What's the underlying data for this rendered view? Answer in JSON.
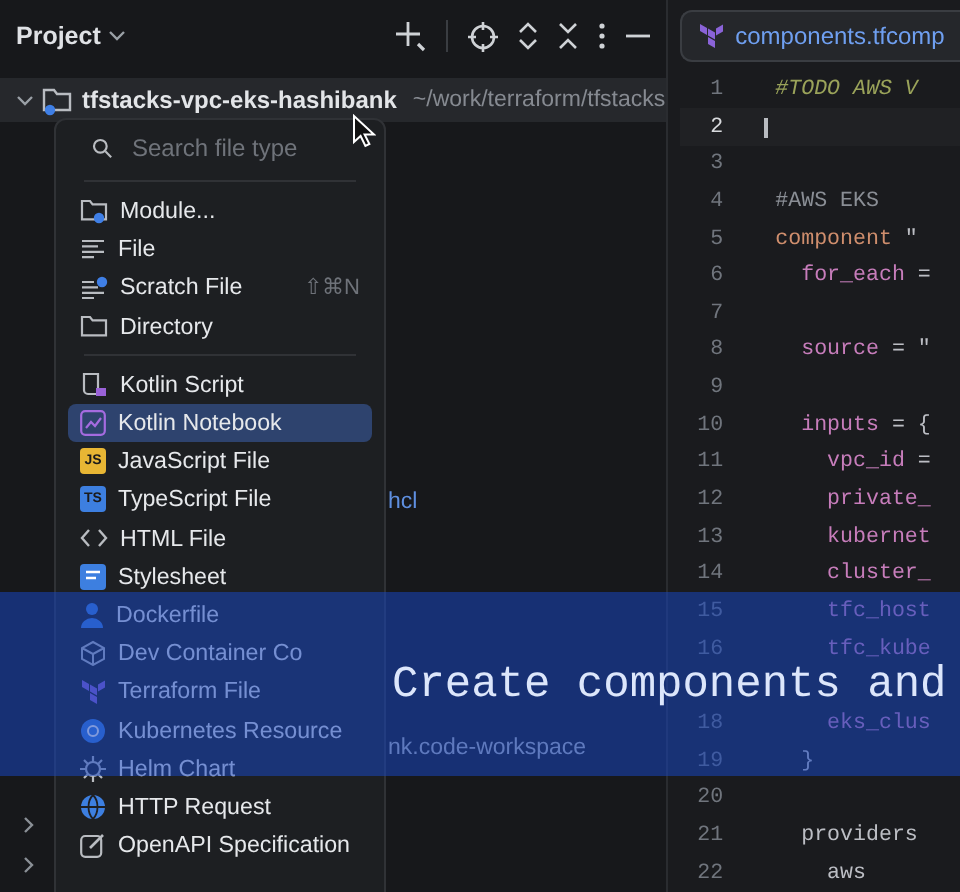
{
  "project_panel": {
    "title": "Project",
    "root": {
      "name": "tfstacks-vpc-eks-hashibank",
      "path": "~/work/terraform/tfstacks",
      "expanded": true
    },
    "rows": [
      {
        "text": "hcl"
      },
      {
        "text": "nk.code-workspace"
      }
    ],
    "collapsed_rows": [
      {
        "expanded": false
      },
      {
        "expanded": false
      }
    ]
  },
  "new_file_menu": {
    "search": {
      "placeholder": "Search file type"
    },
    "groups": [
      [
        {
          "label": "Module...",
          "kind": "module",
          "selected": false
        },
        {
          "label": "File",
          "kind": "file",
          "selected": false
        },
        {
          "label": "Scratch File",
          "kind": "scratch",
          "shortcut": "⇧⌘N",
          "selected": false
        },
        {
          "label": "Directory",
          "kind": "folder",
          "selected": false
        }
      ],
      [
        {
          "label": "Kotlin Script",
          "kind": "kscript",
          "selected": false
        },
        {
          "label": "Kotlin Notebook",
          "kind": "notebook",
          "selected": true
        },
        {
          "label": "JavaScript File",
          "kind": "badge",
          "badge": "JS",
          "color": "#e8b634",
          "selected": false
        },
        {
          "label": "TypeScript File",
          "kind": "badge",
          "badge": "TS",
          "color": "#3d7fe0",
          "selected": false
        },
        {
          "label": "HTML File",
          "kind": "html",
          "selected": false
        },
        {
          "label": "Stylesheet",
          "kind": "css",
          "selected": false
        },
        {
          "label": "Dockerfile",
          "kind": "docker",
          "selected": false
        },
        {
          "label": "Dev Container Co",
          "kind": "cube",
          "selected": false
        },
        {
          "label": "Terraform File",
          "kind": "terraform",
          "selected": false
        },
        {
          "label": "Kubernetes Resource",
          "kind": "k8s",
          "selected": false
        },
        {
          "label": "Helm Chart",
          "kind": "helm",
          "selected": false
        },
        {
          "label": "HTTP Request",
          "kind": "globe",
          "selected": false
        },
        {
          "label": "OpenAPI Specification",
          "kind": "openapi",
          "selected": false
        }
      ]
    ]
  },
  "editor": {
    "tab": "components.tfcomp",
    "lines": [
      {
        "num": "1",
        "current": false,
        "tokens": [
          {
            "text": "#TODO AWS V",
            "kind": "todo"
          }
        ]
      },
      {
        "num": "2",
        "current": true
      },
      {
        "num": "3",
        "current": false
      },
      {
        "num": "4",
        "current": false,
        "tokens": [
          {
            "text": "#AWS EKS",
            "kind": "comment"
          }
        ]
      },
      {
        "num": "5",
        "current": false,
        "tokens": [
          {
            "text": "component",
            "kind": "keyword"
          },
          {
            "text": " \"",
            "kind": "plain"
          }
        ]
      },
      {
        "num": "6",
        "current": false,
        "tokens": [
          {
            "text": "  for_each",
            "kind": "prop"
          },
          {
            "text": " =",
            "kind": "plain"
          }
        ]
      },
      {
        "num": "7",
        "current": false
      },
      {
        "num": "8",
        "current": false,
        "tokens": [
          {
            "text": "  source",
            "kind": "prop"
          },
          {
            "text": " = \"",
            "kind": "plain"
          }
        ]
      },
      {
        "num": "9",
        "current": false
      },
      {
        "num": "10",
        "current": false,
        "tokens": [
          {
            "text": "  inputs",
            "kind": "prop"
          },
          {
            "text": " = {",
            "kind": "plain"
          }
        ]
      },
      {
        "num": "11",
        "current": false,
        "tokens": [
          {
            "text": "    vpc_id",
            "kind": "prop"
          },
          {
            "text": " =",
            "kind": "plain"
          }
        ]
      },
      {
        "num": "12",
        "current": false,
        "tokens": [
          {
            "text": "    private_",
            "kind": "prop"
          }
        ]
      },
      {
        "num": "13",
        "current": false,
        "tokens": [
          {
            "text": "    kubernet",
            "kind": "prop"
          }
        ]
      },
      {
        "num": "14",
        "current": false,
        "tokens": [
          {
            "text": "    cluster_",
            "kind": "prop"
          }
        ]
      },
      {
        "num": "15",
        "current": false,
        "tokens": [
          {
            "text": "    tfc_host",
            "kind": "prop"
          }
        ]
      },
      {
        "num": "16",
        "current": false,
        "tokens": [
          {
            "text": "    tfc_kube",
            "kind": "prop"
          }
        ]
      },
      {
        "current": false
      },
      {
        "num": "18",
        "current": false,
        "tokens": [
          {
            "text": "    eks_clus",
            "kind": "prop"
          }
        ]
      },
      {
        "num": "19",
        "current": false,
        "tokens": [
          {
            "text": "  }",
            "kind": "plain"
          }
        ]
      },
      {
        "num": "20",
        "current": false
      },
      {
        "num": "21",
        "current": false,
        "tokens": [
          {
            "text": "  providers",
            "kind": "plain"
          }
        ]
      },
      {
        "num": "22",
        "current": false,
        "tokens": [
          {
            "text": "    aws",
            "kind": "plain"
          }
        ]
      }
    ]
  },
  "caption": "Create components and"
}
